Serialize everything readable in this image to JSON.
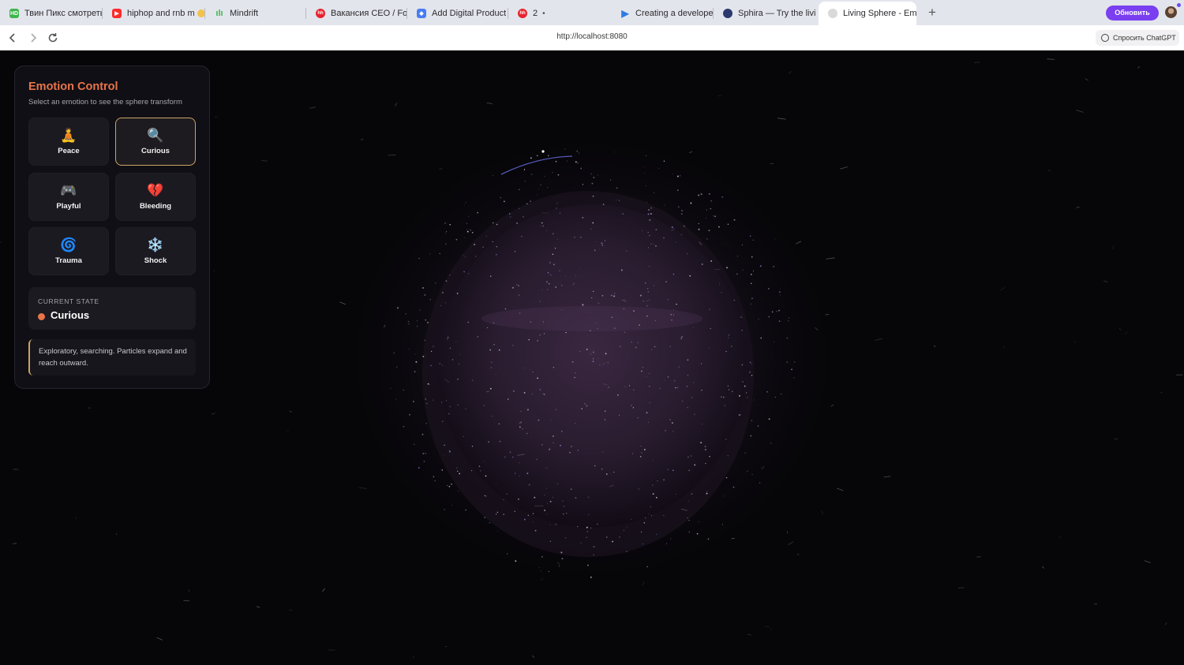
{
  "browser": {
    "tabs": [
      {
        "title": "Твин Пикс смотреть",
        "icon": "hd-favicon-icon",
        "color": "#3fb54d"
      },
      {
        "title": "hiphop and rnb m",
        "icon": "youtube-icon",
        "color": "#ff2b2b"
      },
      {
        "title": "Mindrift",
        "icon": "mindrift-icon",
        "color": "#3fb54d"
      },
      {
        "title": "Вакансия CEO / Fou",
        "icon": "hh-icon",
        "color": "#e8232e"
      },
      {
        "title": "Add Digital Product",
        "icon": "shield-icon",
        "color": "#4a7cf3"
      },
      {
        "title": "2",
        "icon": "hh-icon",
        "color": "#e8232e"
      },
      {
        "title": "Creating a developer",
        "icon": "play-arrow-icon",
        "color": "#2d7be5"
      },
      {
        "title": "Sphira — Try the livin",
        "icon": "globe-icon",
        "color": "#2a3a6e"
      },
      {
        "title": "Living Sphere - Emot",
        "icon": "globe-icon",
        "color": "#c7c7c7"
      }
    ],
    "update_button": "Обновить",
    "url": "http://localhost:8080",
    "ask_chatgpt": "Спросить ChatGPT"
  },
  "panel": {
    "title": "Emotion Control",
    "subtitle": "Select an emotion to see the sphere transform",
    "emotions": [
      {
        "label": "Peace",
        "icon": "🧘",
        "icon_name": "meditation-icon"
      },
      {
        "label": "Curious",
        "icon": "🔍",
        "icon_name": "magnifier-icon"
      },
      {
        "label": "Playful",
        "icon": "🎮",
        "icon_name": "gamepad-icon"
      },
      {
        "label": "Bleeding",
        "icon": "💔",
        "icon_name": "broken-heart-icon"
      },
      {
        "label": "Trauma",
        "icon": "🌀",
        "icon_name": "spiral-icon"
      },
      {
        "label": "Shock",
        "icon": "❄️",
        "icon_name": "snowflake-icon"
      }
    ],
    "selected_emotion": "Curious",
    "state_header": "CURRENT STATE",
    "state_value": "Curious",
    "state_color": "#e8744a",
    "description": "Exploratory, searching. Particles expand and reach outward."
  },
  "colors": {
    "accent": "#e8744a",
    "selection_border": "#c9a564",
    "update_button": "#7a3ff0",
    "sphere": "#3a2740"
  }
}
